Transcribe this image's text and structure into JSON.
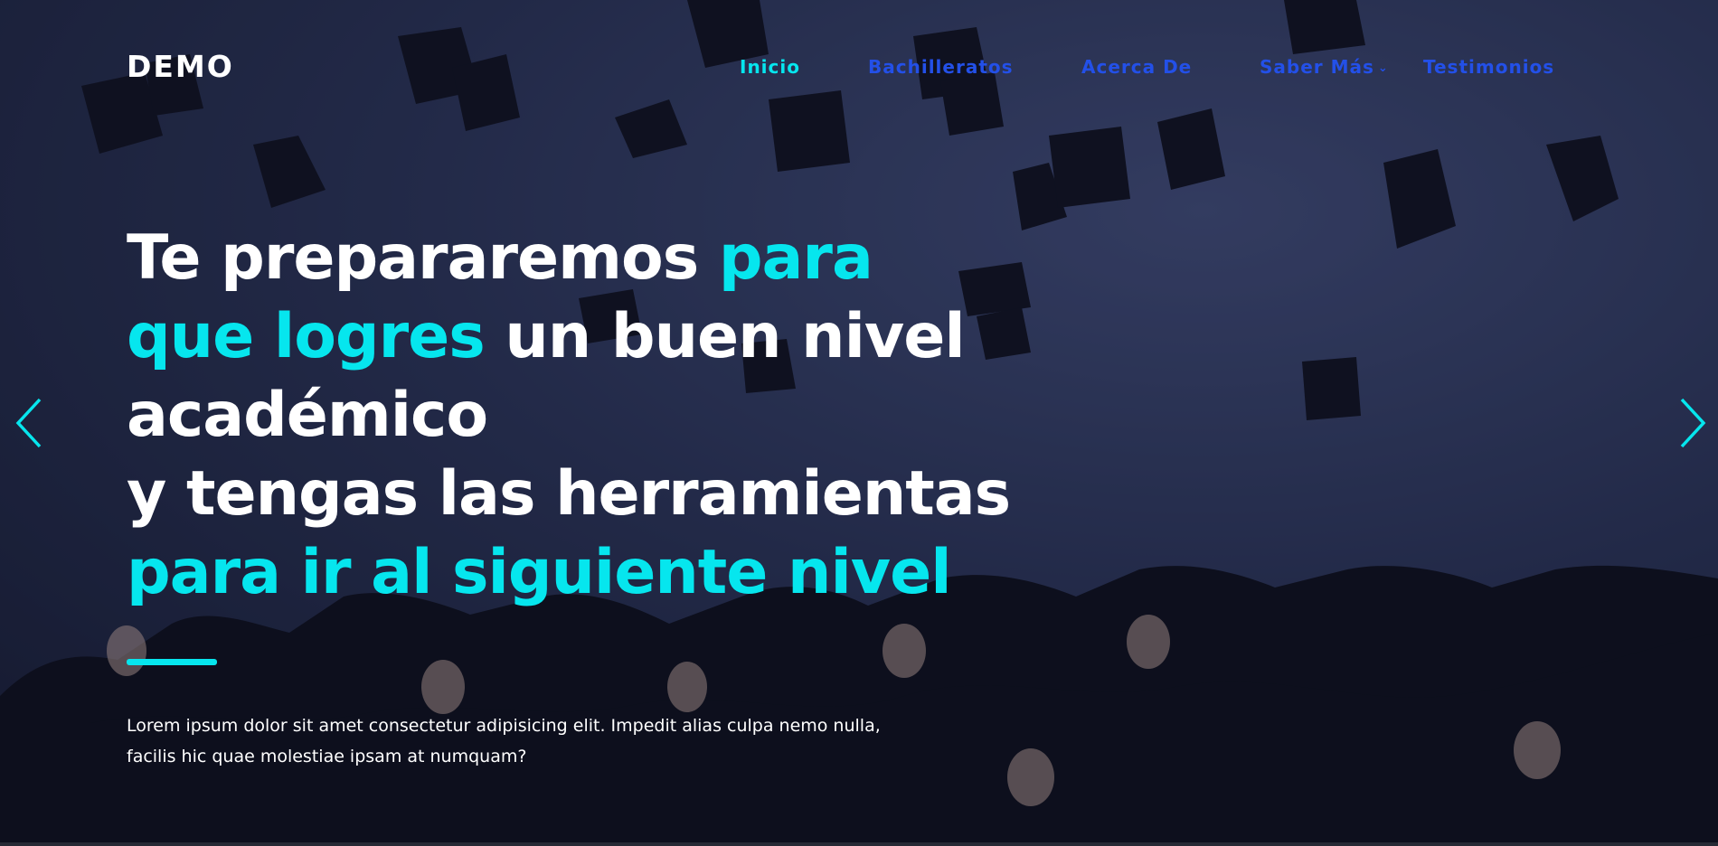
{
  "brand": "DEMO",
  "nav": [
    {
      "label": "Inicio",
      "active": true
    },
    {
      "label": "Bachilleratos",
      "active": false
    },
    {
      "label": "Acerca De",
      "active": false
    },
    {
      "label": "Saber Más",
      "active": false,
      "dropdown": true
    },
    {
      "label": "Testimonios",
      "active": false
    }
  ],
  "hero": {
    "line1": [
      "Te prepararemos ",
      "para"
    ],
    "line2": [
      "que logres",
      " un buen nivel"
    ],
    "line3": "académico",
    "line4": "y tengas las herramientas",
    "line5": "para ir al siguiente nivel",
    "description": "Lorem ipsum dolor sit amet consectetur adipisicing elit. Impedit alias culpa nemo nulla, facilis hic quae molestiae ipsam at numquam?"
  },
  "icons": {
    "prev": "chevron-left-icon",
    "next": "chevron-right-icon",
    "dropdown": "chevron-down-icon"
  },
  "colors": {
    "accent": "#06e6ee",
    "nav_link": "#2350e8",
    "text": "#ffffff",
    "background": "#283252"
  }
}
